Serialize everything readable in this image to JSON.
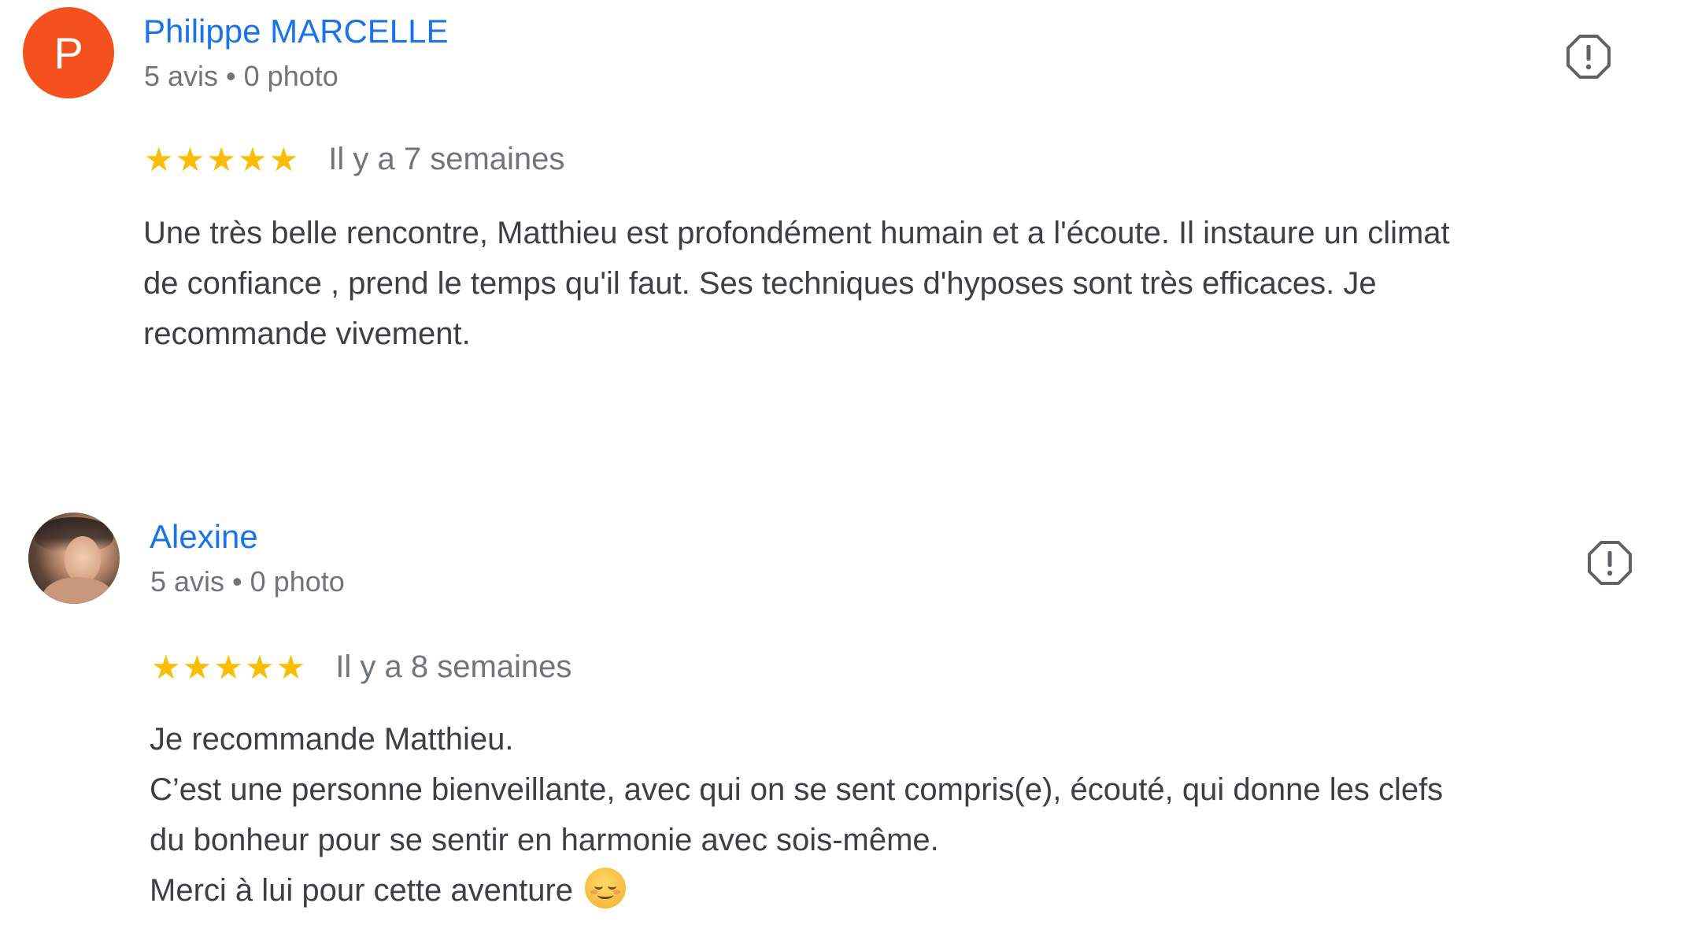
{
  "colors": {
    "name_link": "#1a73e8",
    "star": "#fbbc04",
    "meta_text": "#70757a",
    "body_text": "#3c4043",
    "avatar_p_bg": "#f4511e"
  },
  "reviews": [
    {
      "avatar_letter": "P",
      "name": "Philippe MARCELLE",
      "meta": "5 avis • 0 photo",
      "rating": 5,
      "stars": [
        "★",
        "★",
        "★",
        "★",
        "★"
      ],
      "time": "Il y a 7 semaines",
      "text_lines": [
        "Une très belle rencontre, Matthieu est profondément humain et a l'écoute. Il instaure un climat",
        "de confiance , prend le temps qu'il faut. Ses techniques d'hyposes sont très efficaces. Je",
        "recommande vivement."
      ],
      "flag_icon": "report-flag-icon"
    },
    {
      "avatar_icon": "profile-photo",
      "name": "Alexine",
      "meta": "5 avis • 0 photo",
      "rating": 5,
      "stars": [
        "★",
        "★",
        "★",
        "★",
        "★"
      ],
      "time": "Il y a 8 semaines",
      "text_lines": [
        "Je recommande Matthieu.",
        "C’est une personne bienveillante, avec qui on se sent compris(e), écouté, qui donne les clefs",
        "du bonheur pour se sentir en harmonie avec sois-même.",
        "Merci à lui pour cette aventure"
      ],
      "emoji_icon": "smiling-face-emoji-icon",
      "flag_icon": "report-flag-icon"
    }
  ]
}
